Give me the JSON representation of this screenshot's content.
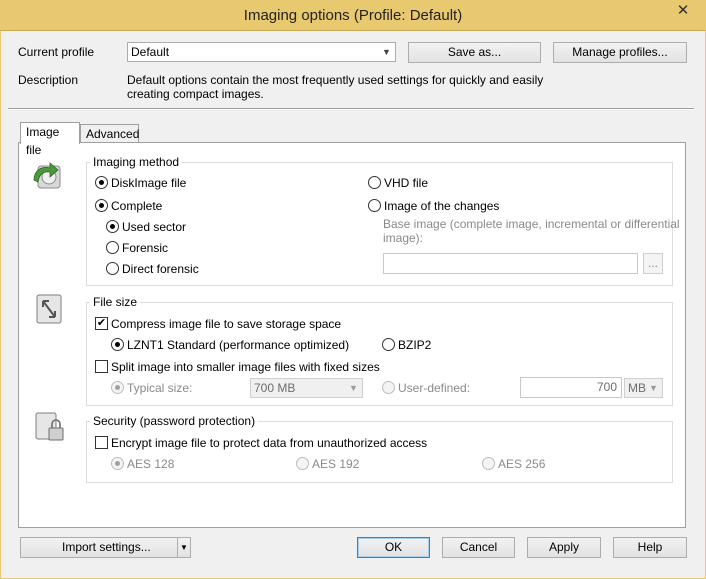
{
  "window": {
    "title": "Imaging options (Profile: Default)",
    "close_glyph": "✕"
  },
  "profile": {
    "current_label": "Current profile",
    "current_value": "Default",
    "save_as_label": "Save as...",
    "manage_label": "Manage profiles...",
    "description_label": "Description",
    "description_line1": "Default options contain the most frequently used settings for quickly and easily",
    "description_line2": "creating compact images."
  },
  "tabs": [
    {
      "label": "Image file",
      "active": true
    },
    {
      "label": "Advanced",
      "active": false
    }
  ],
  "imaging_method": {
    "title": "Imaging method",
    "diskimage_label": "DiskImage file",
    "diskimage_selected": true,
    "vhd_label": "VHD file",
    "vhd_selected": false,
    "complete_label": "Complete",
    "complete_selected": true,
    "changes_label": "Image of the changes",
    "changes_selected": false,
    "used_sector_label": "Used sector",
    "used_sector_selected": true,
    "forensic_label": "Forensic",
    "forensic_selected": false,
    "direct_forensic_label": "Direct forensic",
    "direct_forensic_selected": false,
    "base_image_line1": "Base image (complete image, incremental or differential",
    "base_image_line2": "image):",
    "base_image_value": "",
    "browse_label": "..."
  },
  "file_size": {
    "title": "File size",
    "compress_label": "Compress image file to save storage space",
    "compress_checked": true,
    "lznt1_label": "LZNT1 Standard (performance optimized)",
    "lznt1_selected": true,
    "bzip2_label": "BZIP2",
    "bzip2_selected": false,
    "split_label": "Split image into smaller image files with fixed sizes",
    "split_checked": false,
    "typical_label": "Typical size:",
    "typical_selected": true,
    "typical_value": "700 MB",
    "user_defined_label": "User-defined:",
    "user_defined_selected": false,
    "user_defined_value": "700",
    "unit_value": "MB"
  },
  "security": {
    "title": "Security (password protection)",
    "encrypt_label": "Encrypt image file to protect data from unauthorized access",
    "encrypt_checked": false,
    "aes128_label": "AES 128",
    "aes128_selected": true,
    "aes192_label": "AES 192",
    "aes192_selected": false,
    "aes256_label": "AES 256",
    "aes256_selected": false
  },
  "footer": {
    "import_label": "Import settings...",
    "ok_label": "OK",
    "cancel_label": "Cancel",
    "apply_label": "Apply",
    "help_label": "Help"
  },
  "colors": {
    "titlebar": "#e9c96f",
    "default_button_border": "#3c7fb1",
    "icon_green": "#4a9a3c"
  },
  "icons": [
    "close-icon",
    "chevron-down-icon",
    "imaging-method-icon",
    "file-size-icon",
    "security-icon"
  ]
}
